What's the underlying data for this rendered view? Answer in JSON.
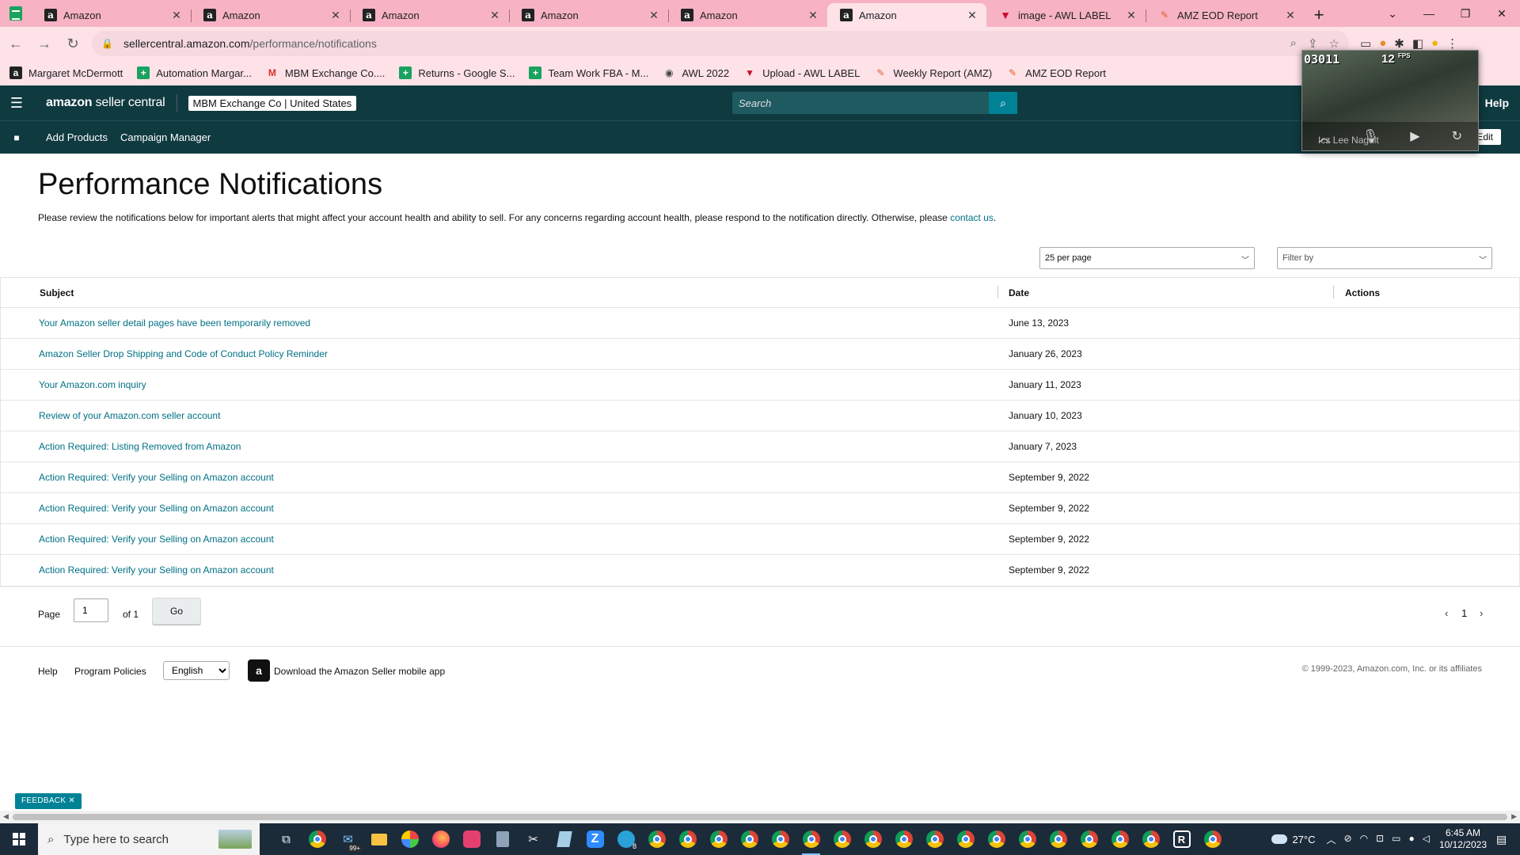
{
  "browser": {
    "tabs": [
      {
        "title": "Amazon",
        "icon": "amazon-icon",
        "active": false
      },
      {
        "title": "Amazon",
        "icon": "amazon-icon",
        "active": false
      },
      {
        "title": "Amazon",
        "icon": "amazon-icon",
        "active": false
      },
      {
        "title": "Amazon",
        "icon": "amazon-icon",
        "active": false
      },
      {
        "title": "Amazon",
        "icon": "amazon-icon",
        "active": false
      },
      {
        "title": "Amazon",
        "icon": "amazon-icon",
        "active": true
      },
      {
        "title": "image - AWL LABEL",
        "icon": "awl-label-icon",
        "active": false
      },
      {
        "title": "AMZ EOD Report",
        "icon": "amz-eod-icon",
        "active": false
      }
    ],
    "url_host": "sellercentral.amazon.com",
    "url_path": "/performance/notifications",
    "bookmarks": [
      {
        "label": "Margaret McDermott",
        "icon": "amazon-icon"
      },
      {
        "label": "Automation Margar...",
        "icon": "sheets-icon"
      },
      {
        "label": "MBM Exchange Co....",
        "icon": "gmail-icon"
      },
      {
        "label": "Returns - Google S...",
        "icon": "sheets-icon"
      },
      {
        "label": "Team Work FBA - M...",
        "icon": "sheets-icon"
      },
      {
        "label": "AWL 2022",
        "icon": "globe-icon"
      },
      {
        "label": "Upload - AWL LABEL",
        "icon": "awl-label-icon"
      },
      {
        "label": "Weekly Report (AMZ)",
        "icon": "amz-eod-icon"
      },
      {
        "label": "AMZ EOD Report",
        "icon": "amz-eod-icon"
      }
    ],
    "theme_color": "#f7b3c3"
  },
  "video_overlay": {
    "counter": "03011",
    "fps": "12",
    "fps_unit": "FPS",
    "participant": "Icz Lee Nagult"
  },
  "seller_central": {
    "logo_strong": "amazon",
    "logo_rest": " seller central",
    "account": "MBM Exchange Co | United States",
    "search_placeholder": "Search",
    "help": "Help",
    "nav": [
      "Add Products",
      "Campaign Manager"
    ],
    "edit": "Edit",
    "header_color": "#0f3a40",
    "link_color": "#007185"
  },
  "page": {
    "title": "Performance Notifications",
    "intro": "Please review the notifications below for important alerts that might affect your account health and ability to sell. For any concerns regarding account health, please respond to the notification directly. Otherwise, please ",
    "intro_link": "contact us",
    "intro_end": ".",
    "per_page": "25 per page",
    "filter_placeholder": "Filter by"
  },
  "table": {
    "columns": [
      "Subject",
      "Date",
      "Actions"
    ],
    "rows": [
      {
        "subject": "Your Amazon seller detail pages have been temporarily removed",
        "date": "June 13, 2023"
      },
      {
        "subject": "Amazon Seller Drop Shipping and Code of Conduct Policy Reminder",
        "date": "January 26, 2023"
      },
      {
        "subject": "Your Amazon.com inquiry",
        "date": "January 11, 2023"
      },
      {
        "subject": "Review of your Amazon.com seller account",
        "date": "January 10, 2023"
      },
      {
        "subject": "Action Required: Listing Removed from Amazon",
        "date": "January 7, 2023"
      },
      {
        "subject": "Action Required: Verify your Selling on Amazon account",
        "date": "September 9, 2022"
      },
      {
        "subject": "Action Required: Verify your Selling on Amazon account",
        "date": "September 9, 2022"
      },
      {
        "subject": "Action Required: Verify your Selling on Amazon account",
        "date": "September 9, 2022"
      },
      {
        "subject": "Action Required: Verify your Selling on Amazon account",
        "date": "September 9, 2022"
      }
    ]
  },
  "pager": {
    "page_label": "Page",
    "page_value": "1",
    "of_label": "of 1",
    "go": "Go",
    "current": "1"
  },
  "footer": {
    "help": "Help",
    "policies": "Program Policies",
    "language": "English",
    "app_text": "Download the Amazon Seller mobile app",
    "copyright": "© 1999-2023, Amazon.com, Inc. or its affiliates"
  },
  "feedback": "FEEDBACK",
  "taskbar": {
    "search_placeholder": "Type here to search",
    "mail_badge": "99+",
    "telegram_badge": "8",
    "temperature": "27°C",
    "time": "6:45 AM",
    "date": "10/12/2023"
  }
}
